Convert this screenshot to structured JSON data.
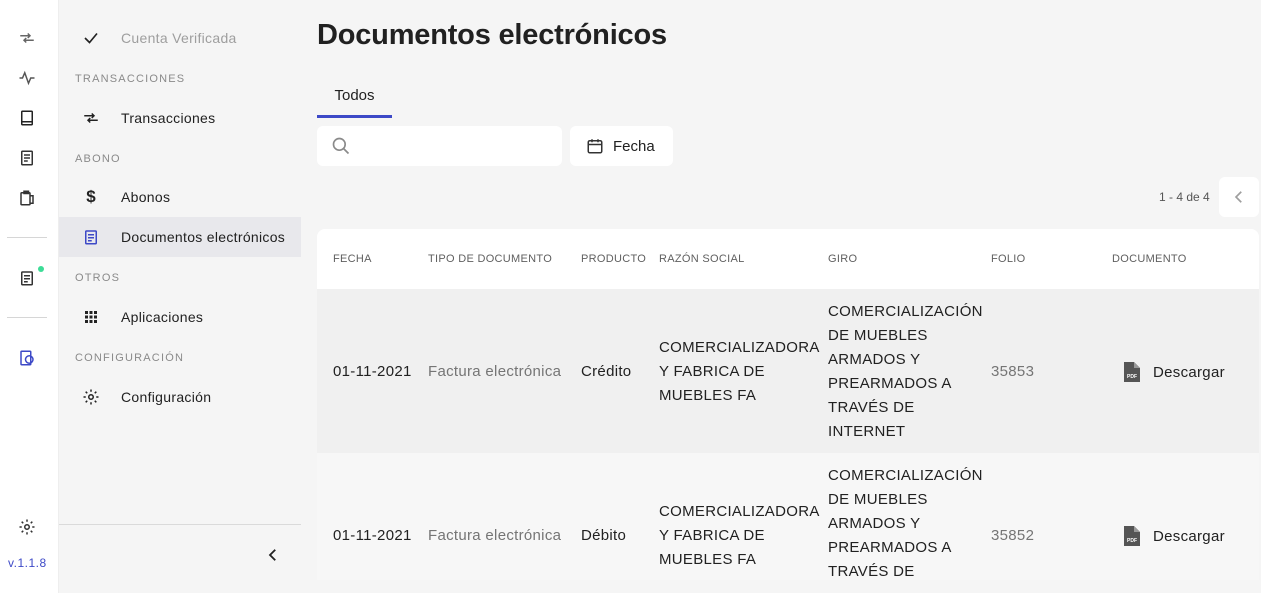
{
  "app": {
    "version": "v.1.1.8",
    "accent_color": "#3d49c7",
    "status_dot_color": "#3ddc97"
  },
  "rail": {
    "icons": [
      "swap-arrows-icon",
      "activity-icon",
      "book-icon",
      "receipt-icon",
      "clipboard-icon",
      "documents-icon",
      "finance-icon",
      "settings-icon"
    ]
  },
  "sidebar": {
    "verified_label": "Cuenta Verificada",
    "sections": {
      "transacciones": "TRANSACCIONES",
      "abono": "ABONO",
      "otros": "OTROS",
      "configuracion": "CONFIGURACIÓN"
    },
    "items": {
      "transacciones": "Transacciones",
      "abonos": "Abonos",
      "documentos": "Documentos electrónicos",
      "aplicaciones": "Aplicaciones",
      "configuracion": "Configuración"
    }
  },
  "main": {
    "title": "Documentos electrónicos",
    "tabs": [
      {
        "label": "Todos",
        "active": true
      }
    ],
    "search": {
      "placeholder": "",
      "value": ""
    },
    "date_filter_label": "Fecha",
    "pagination": "1 - 4 de 4"
  },
  "table": {
    "headers": {
      "fecha": "FECHA",
      "tipo": "TIPO DE DOCUMENTO",
      "producto": "PRODUCTO",
      "razon": "RAZÓN SOCIAL",
      "giro": "GIRO",
      "folio": "FOLIO",
      "documento": "DOCUMENTO"
    },
    "rows": [
      {
        "fecha": "01-11-2021",
        "tipo": "Factura electrónica",
        "producto": "Crédito",
        "razon": "COMERCIALIZADORA Y FABRICA DE MUEBLES FA",
        "giro": "COMERCIALIZACIÓN DE MUEBLES ARMADOS Y PREARMADOS A TRAVÉS DE INTERNET",
        "folio": "35853",
        "documento": "Descargar"
      },
      {
        "fecha": "01-11-2021",
        "tipo": "Factura electrónica",
        "producto": "Débito",
        "razon": "COMERCIALIZADORA Y FABRICA DE MUEBLES FA",
        "giro": "COMERCIALIZACIÓN DE MUEBLES ARMADOS Y PREARMADOS A TRAVÉS DE INTERNET",
        "folio": "35852",
        "documento": "Descargar"
      }
    ]
  }
}
